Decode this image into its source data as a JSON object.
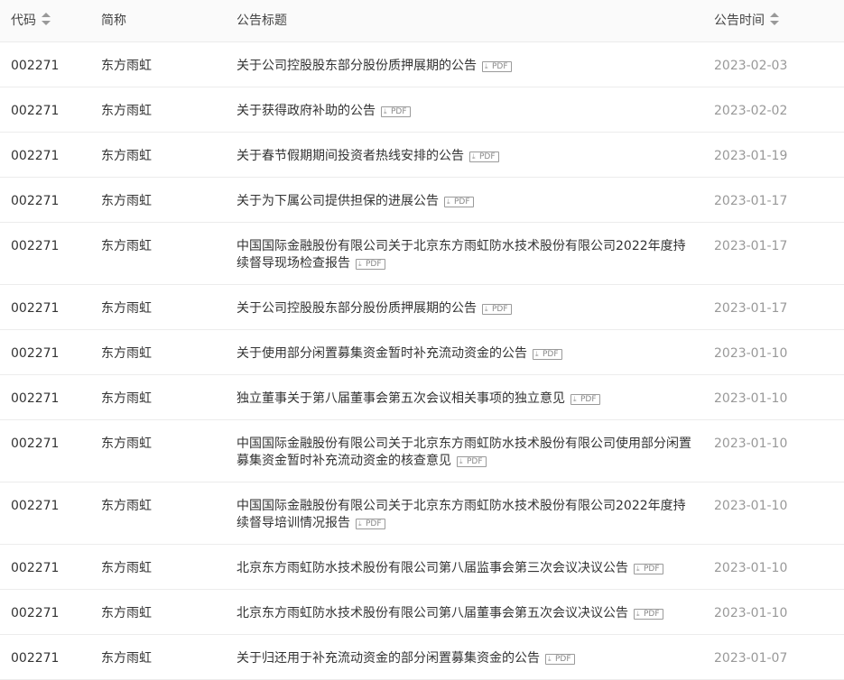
{
  "header": {
    "code": "代码",
    "name": "简称",
    "title": "公告标题",
    "date": "公告时间"
  },
  "pdf_label": "PDF",
  "rows": [
    {
      "code": "002271",
      "name": "东方雨虹",
      "title": "关于公司控股股东部分股份质押展期的公告",
      "date": "2023-02-03",
      "lines": 1
    },
    {
      "code": "002271",
      "name": "东方雨虹",
      "title": "关于获得政府补助的公告",
      "date": "2023-02-02",
      "lines": 1
    },
    {
      "code": "002271",
      "name": "东方雨虹",
      "title": "关于春节假期期间投资者热线安排的公告",
      "date": "2023-01-19",
      "lines": 1
    },
    {
      "code": "002271",
      "name": "东方雨虹",
      "title": "关于为下属公司提供担保的进展公告",
      "date": "2023-01-17",
      "lines": 1
    },
    {
      "code": "002271",
      "name": "东方雨虹",
      "title": "中国国际金融股份有限公司关于北京东方雨虹防水技术股份有限公司2022年度持续督导现场检查报告",
      "date": "2023-01-17",
      "lines": 2
    },
    {
      "code": "002271",
      "name": "东方雨虹",
      "title": "关于公司控股股东部分股份质押展期的公告",
      "date": "2023-01-17",
      "lines": 1
    },
    {
      "code": "002271",
      "name": "东方雨虹",
      "title": "关于使用部分闲置募集资金暂时补充流动资金的公告",
      "date": "2023-01-10",
      "lines": 1
    },
    {
      "code": "002271",
      "name": "东方雨虹",
      "title": "独立董事关于第八届董事会第五次会议相关事项的独立意见",
      "date": "2023-01-10",
      "lines": 1
    },
    {
      "code": "002271",
      "name": "东方雨虹",
      "title": "中国国际金融股份有限公司关于北京东方雨虹防水技术股份有限公司使用部分闲置募集资金暂时补充流动资金的核查意见",
      "date": "2023-01-10",
      "lines": 2
    },
    {
      "code": "002271",
      "name": "东方雨虹",
      "title": "中国国际金融股份有限公司关于北京东方雨虹防水技术股份有限公司2022年度持续督导培训情况报告",
      "date": "2023-01-10",
      "lines": 2
    },
    {
      "code": "002271",
      "name": "东方雨虹",
      "title": "北京东方雨虹防水技术股份有限公司第八届监事会第三次会议决议公告",
      "date": "2023-01-10",
      "lines": 1
    },
    {
      "code": "002271",
      "name": "东方雨虹",
      "title": "北京东方雨虹防水技术股份有限公司第八届董事会第五次会议决议公告",
      "date": "2023-01-10",
      "lines": 1
    },
    {
      "code": "002271",
      "name": "东方雨虹",
      "title": "关于归还用于补充流动资金的部分闲置募集资金的公告",
      "date": "2023-01-07",
      "lines": 1
    }
  ]
}
